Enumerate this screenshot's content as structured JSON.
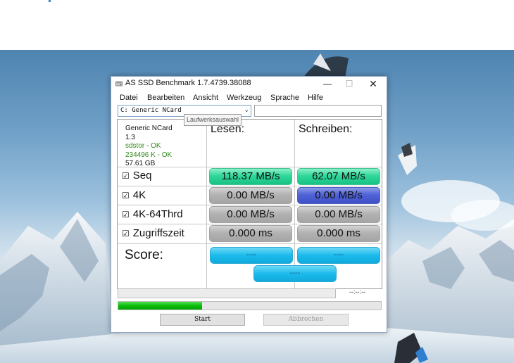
{
  "window": {
    "title": "AS SSD Benchmark 1.7.4739.38088",
    "minimize": "—",
    "maximize": "☐",
    "close": "✕"
  },
  "menu": [
    "Datei",
    "Bearbeiten",
    "Ansicht",
    "Werkzeug",
    "Sprache",
    "Hilfe"
  ],
  "drive": {
    "selected": "C: Generic NCard",
    "tooltip": "Laufwerksauswahl",
    "input_value": ""
  },
  "info": {
    "name": "Generic NCard",
    "version": "1.3",
    "driver": "sdstor - OK",
    "alignment": "234496 K - OK",
    "size": "57.61 GB"
  },
  "headers": {
    "read": "Lesen:",
    "write": "Schreiben:"
  },
  "rows": [
    {
      "label": "Seq",
      "read": "118.37 MB/s",
      "write": "62.07 MB/s",
      "read_style": "green",
      "write_style": "green"
    },
    {
      "label": "4K",
      "read": "0.00 MB/s",
      "write": "0.00 MB/s",
      "read_style": "gray",
      "write_style": "blue"
    },
    {
      "label": "4K-64Thrd",
      "read": "0.00 MB/s",
      "write": "0.00 MB/s",
      "read_style": "gray",
      "write_style": "gray"
    },
    {
      "label": "Zugriffszeit",
      "read": "0.000 ms",
      "write": "0.000 ms",
      "read_style": "gray",
      "write_style": "gray"
    }
  ],
  "checkbox_glyph": "☑",
  "score": {
    "label": "Score:",
    "read": "----",
    "write": "----",
    "total": "----"
  },
  "progress": {
    "time": "--:--:--",
    "fraction": 0.32
  },
  "buttons": {
    "start": "Start",
    "abort": "Abbrechen"
  },
  "colors": {
    "green_result": "#2fd79a",
    "blue_result": "#4f62d6",
    "gray_result": "#b2b2b2",
    "score": "#1bbbec",
    "progress": "#08b908"
  }
}
